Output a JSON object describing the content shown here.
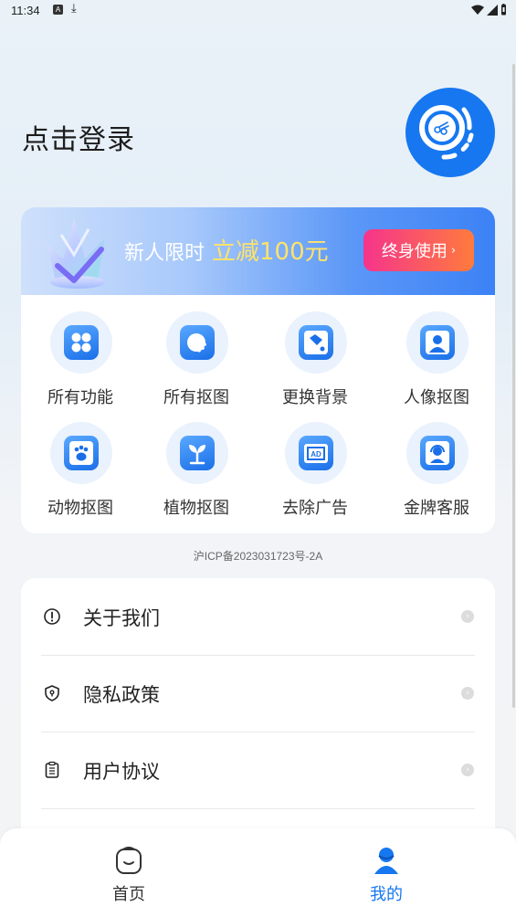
{
  "status_bar": {
    "time": "11:34",
    "notification_a": "A",
    "download_glyph": "⤓"
  },
  "header": {
    "login_label": "点击登录",
    "logo_icon": "scissors-logo-icon",
    "accent_color": "#1677f0"
  },
  "promo": {
    "text": "新人限时",
    "highlight": "立减100元",
    "button_label": "终身使用",
    "button_chevron": "›"
  },
  "features": [
    {
      "label": "所有功能",
      "icon": "grid-icon"
    },
    {
      "label": "所有抠图",
      "icon": "cutout-icon"
    },
    {
      "label": "更换背景",
      "icon": "paint-bucket-icon"
    },
    {
      "label": "人像抠图",
      "icon": "portrait-icon"
    },
    {
      "label": "动物抠图",
      "icon": "paw-icon"
    },
    {
      "label": "植物抠图",
      "icon": "plant-icon"
    },
    {
      "label": "去除广告",
      "icon": "ad-icon"
    },
    {
      "label": "金牌客服",
      "icon": "customer-service-icon"
    }
  ],
  "icp": "沪ICP备2023031723号-2A",
  "menu": [
    {
      "label": "关于我们",
      "icon": "info-icon"
    },
    {
      "label": "隐私政策",
      "icon": "shield-icon"
    },
    {
      "label": "用户协议",
      "icon": "clipboard-icon"
    }
  ],
  "tabbar": {
    "home_label": "首页",
    "mine_label": "我的",
    "active_color": "#1677f0",
    "inactive_color": "#333333"
  }
}
